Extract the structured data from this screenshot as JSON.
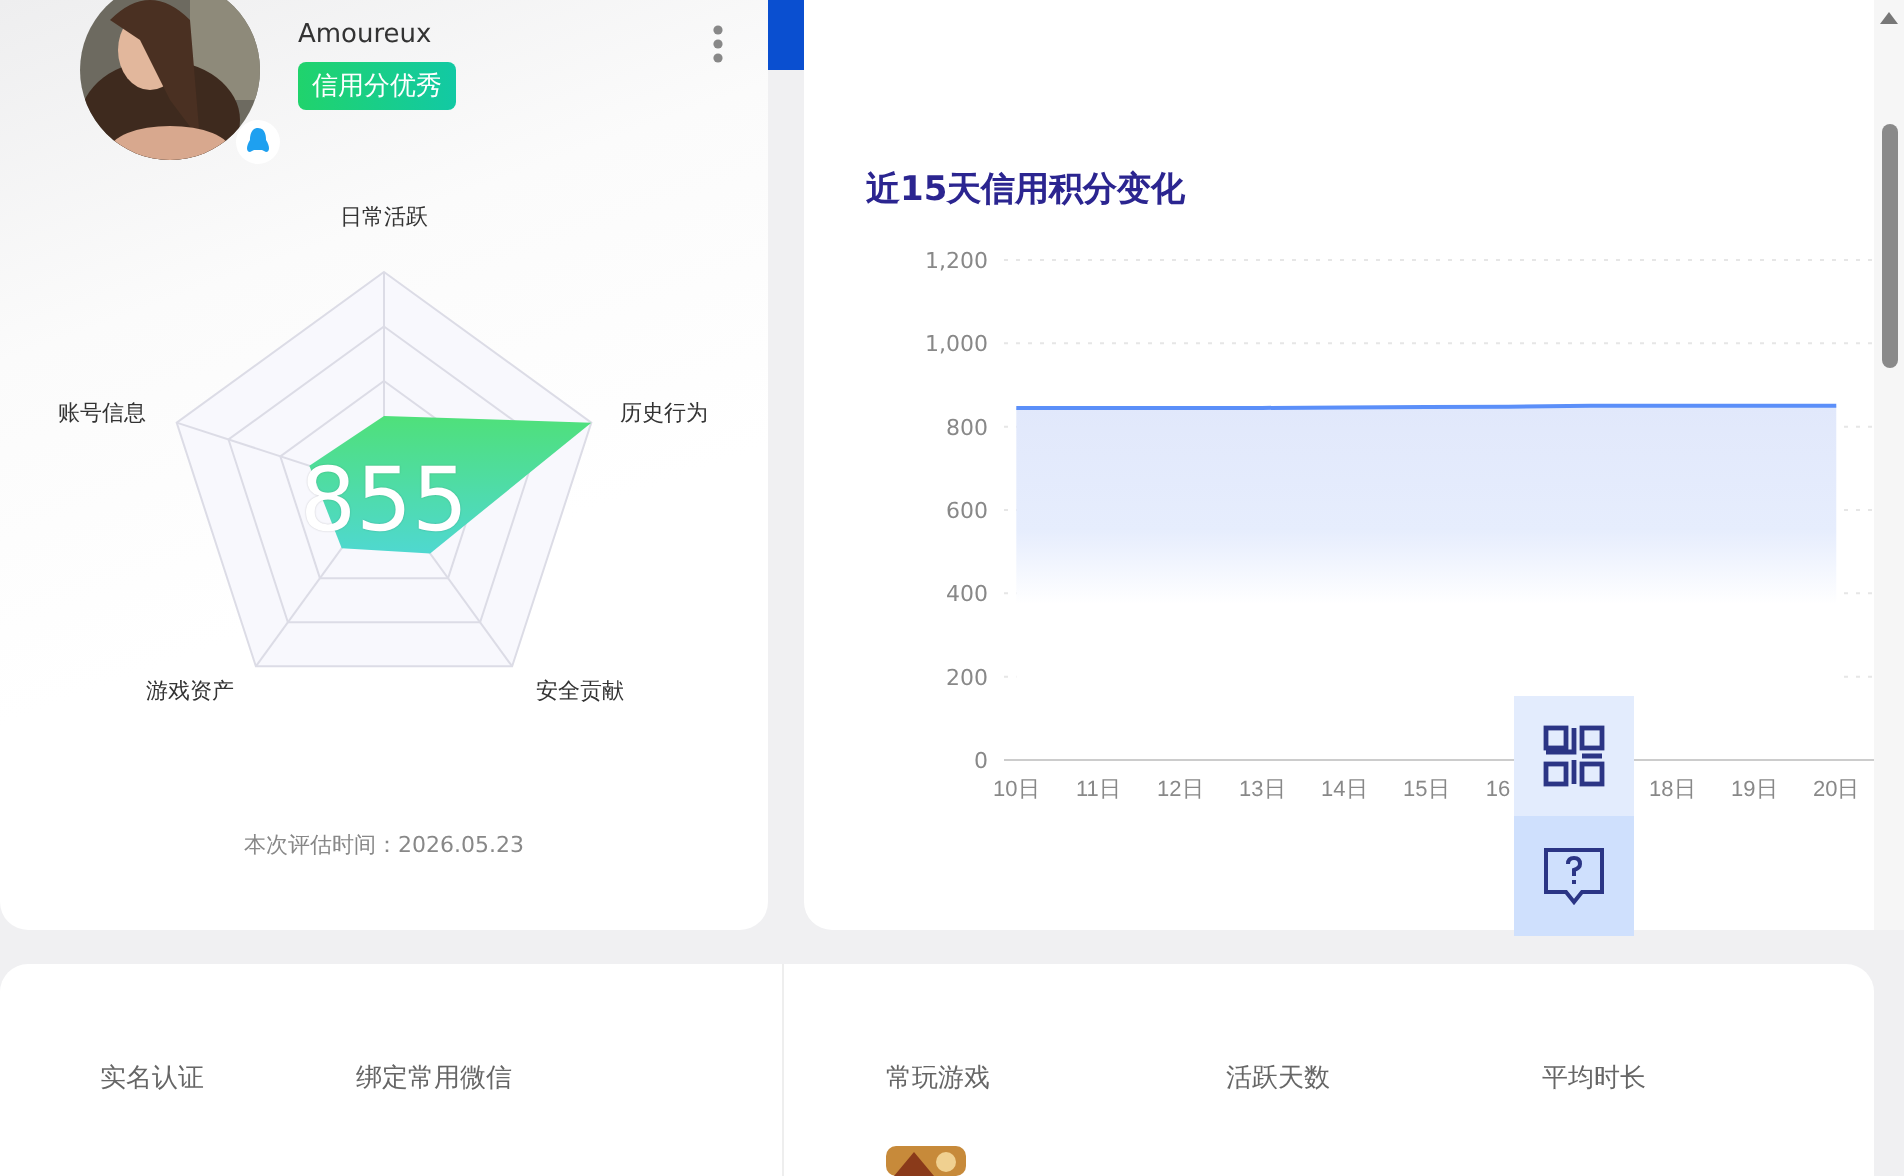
{
  "profile": {
    "name": "Amoureux",
    "badge": "信用分优秀"
  },
  "radar": {
    "score": "855",
    "labels": [
      "日常活跃",
      "历史行为",
      "安全贡献",
      "游戏资产",
      "账号信息"
    ],
    "evaluated": "本次评估时间：2026.05.23"
  },
  "trend": {
    "title": "近15天信用积分变化",
    "chart_data": {
      "type": "area",
      "grid": true,
      "xlim": [
        9.85,
        20.46
      ],
      "x": [
        10,
        11,
        12,
        13,
        14,
        15,
        16,
        17,
        18,
        19,
        20
      ],
      "xticks": [
        {
          "value": 10,
          "label": "10日"
        },
        {
          "value": 11,
          "label": "11日"
        },
        {
          "value": 12,
          "label": "12日"
        },
        {
          "value": 13,
          "label": "13日"
        },
        {
          "value": 14,
          "label": "14日"
        },
        {
          "value": 15,
          "label": "15日"
        },
        {
          "value": 16,
          "label": "16"
        },
        {
          "value": 18,
          "label": "18日"
        },
        {
          "value": 19,
          "label": "19日"
        },
        {
          "value": 20,
          "label": "20日"
        }
      ],
      "series": [
        {
          "color": "#5b8ff9",
          "values": [
            845,
            845,
            845,
            845,
            846,
            847,
            848,
            850,
            850,
            850,
            850
          ]
        }
      ],
      "ylim": [
        0,
        1200
      ],
      "yticks": [
        {
          "value": 0,
          "label": "0"
        },
        {
          "value": 200,
          "label": "200"
        },
        {
          "value": 400,
          "label": "400"
        },
        {
          "value": 600,
          "label": "600"
        },
        {
          "value": 800,
          "label": "800"
        },
        {
          "value": 1000,
          "label": "1,000"
        },
        {
          "value": 1200,
          "label": "1,200"
        }
      ]
    }
  },
  "bottom": {
    "left_columns": [
      "实名认证",
      "绑定常用微信"
    ],
    "right_columns": [
      "常玩游戏",
      "活跃天数",
      "平均时长"
    ],
    "game": {
      "kind": "picture"
    }
  }
}
